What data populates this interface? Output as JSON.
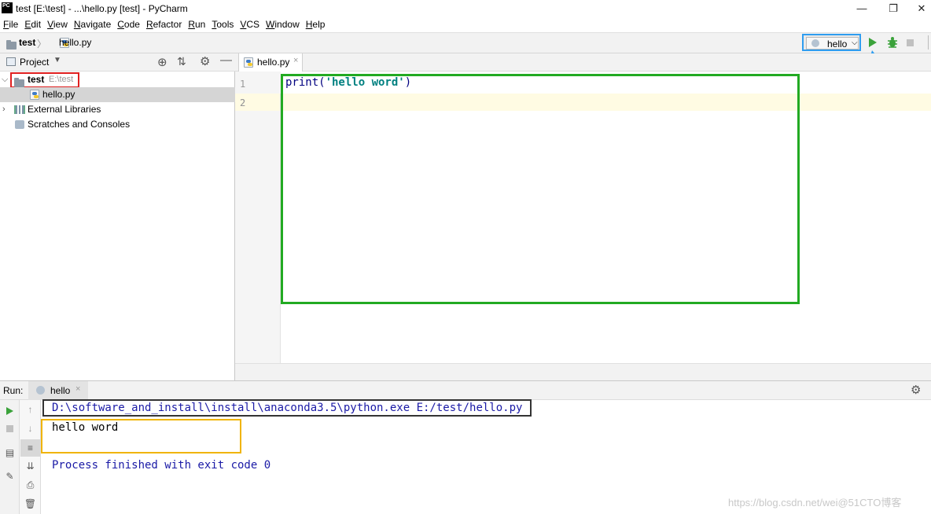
{
  "window": {
    "app_icon_label": "PC",
    "title": "test [E:\\test] - ...\\hello.py [test] - PyCharm",
    "controls": [
      "—",
      "❐",
      "✕"
    ]
  },
  "menu": [
    "File",
    "Edit",
    "View",
    "Navigate",
    "Code",
    "Refactor",
    "Run",
    "Tools",
    "VCS",
    "Window",
    "Help"
  ],
  "breadcrumb": {
    "project": "test",
    "separator": "〉",
    "file": "hello.py"
  },
  "run_config": {
    "name": "hello",
    "run_icon": "run-icon",
    "debug_icon": "debug-icon",
    "stop_icon": "stop-icon"
  },
  "project_panel": {
    "title": "Project",
    "tree": [
      {
        "label": "test",
        "path": "E:\\test",
        "icon": "folder-icon"
      },
      {
        "label": "hello.py",
        "icon": "python-file-icon"
      },
      {
        "label": "External Libraries",
        "icon": "library-icon"
      },
      {
        "label": "Scratches and Consoles",
        "icon": "scratches-icon"
      }
    ]
  },
  "editor": {
    "tab_label": "hello.py",
    "line_numbers": [
      "1",
      "2"
    ],
    "code": {
      "func": "print(",
      "string": "'hello word'",
      "close": ")"
    }
  },
  "run_panel": {
    "label": "Run:",
    "tab": "hello",
    "command": "D:\\software_and_install\\install\\anaconda3.5\\python.exe E:/test/hello.py",
    "output": "hello word",
    "exit_message": "Process finished with exit code 0"
  },
  "watermark": "https://blog.csdn.net/wei@51CTO博客",
  "colors": {
    "accent_blue": "#2f9df0",
    "highlight_green": "#22aa22",
    "highlight_orange": "#f0b400",
    "highlight_red": "#e02020",
    "console_blue": "#1a1aa6"
  }
}
